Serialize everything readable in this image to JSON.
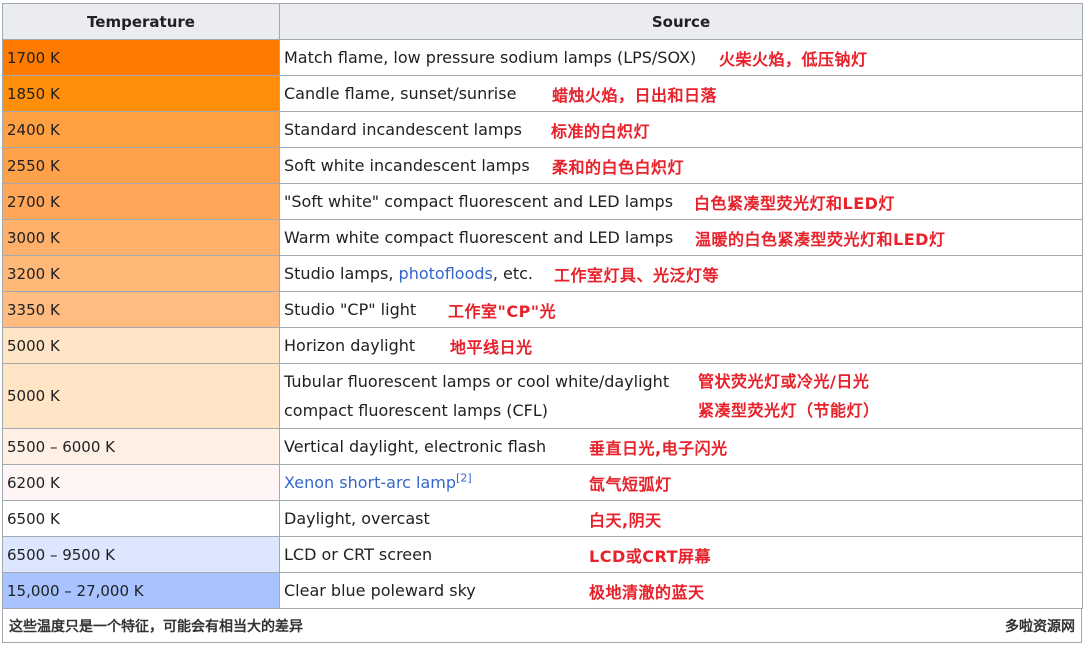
{
  "headers": {
    "temperature": "Temperature",
    "source": "Source"
  },
  "rows": [
    {
      "temp": "1700 K",
      "bg": "#ff7a00",
      "en": "Match flame, low pressure sodium lamps (LPS/SOX)",
      "zh": "火柴火焰，低压钠灯"
    },
    {
      "temp": "1850 K",
      "bg": "#ff8e0b",
      "en": "Candle flame, sunset/sunrise",
      "zh": "蜡烛火焰，日出和日落"
    },
    {
      "temp": "2400 K",
      "bg": "#ffa042",
      "en": "Standard incandescent lamps",
      "zh": "标准的白炽灯"
    },
    {
      "temp": "2550 K",
      "bg": "#ffa14a",
      "en": "Soft white incandescent lamps",
      "zh": "柔和的白色白炽灯"
    },
    {
      "temp": "2700 K",
      "bg": "#ffa658",
      "en": "\"Soft white\" compact fluorescent and LED lamps",
      "zh": "白色紧凑型荧光灯和LED灯"
    },
    {
      "temp": "3000 K",
      "bg": "#ffb06a",
      "en": "Warm white compact fluorescent and LED lamps",
      "zh": "温暖的白色紧凑型荧光灯和LED灯"
    },
    {
      "temp": "3200 K",
      "bg": "#ffb877",
      "en_pre": "Studio lamps, ",
      "en_link": "photofloods",
      "en_post": ", etc.",
      "zh": "工作室灯具、光泛灯等"
    },
    {
      "temp": "3350 K",
      "bg": "#ffbb80",
      "en": "Studio \"CP\" light",
      "zh": "工作室\"CP\"光"
    },
    {
      "temp": "5000 K",
      "bg": "#ffe4c6",
      "en": "Horizon daylight",
      "zh": "地平线日光"
    },
    {
      "temp": "5000 K",
      "bg": "#ffe4c6",
      "en_l1": "Tubular fluorescent lamps or cool white/daylight",
      "en_l2": "compact fluorescent lamps (CFL)",
      "zh_l1": "管状荧光灯或冷光/日光",
      "zh_l2": "紧凑型荧光灯（节能灯）"
    },
    {
      "temp": "5500 – 6000 K",
      "bg": "#fff0e6",
      "en": "Vertical daylight, electronic flash",
      "zh": "垂直日光,电子闪光"
    },
    {
      "temp": "6200 K",
      "bg": "#fff5f5",
      "en_link": "Xenon short-arc lamp",
      "en_sup": "[2]",
      "zh": "氙气短弧灯"
    },
    {
      "temp": "6500 K",
      "bg": "#ffffff",
      "en": "Daylight, overcast",
      "zh": "白天,阴天"
    },
    {
      "temp": "6500 – 9500 K",
      "bg": "#dde6ff",
      "en": "LCD or CRT screen",
      "zh": "LCD或CRT屏幕"
    },
    {
      "temp": "15,000 – 27,000 K",
      "bg": "#a8c3ff",
      "en": "Clear blue poleward sky",
      "zh": "极地清澈的蓝天"
    }
  ],
  "footer": {
    "note": "这些温度只是一个特征，可能会有相当大的差异",
    "brand": "多啦资源网"
  }
}
